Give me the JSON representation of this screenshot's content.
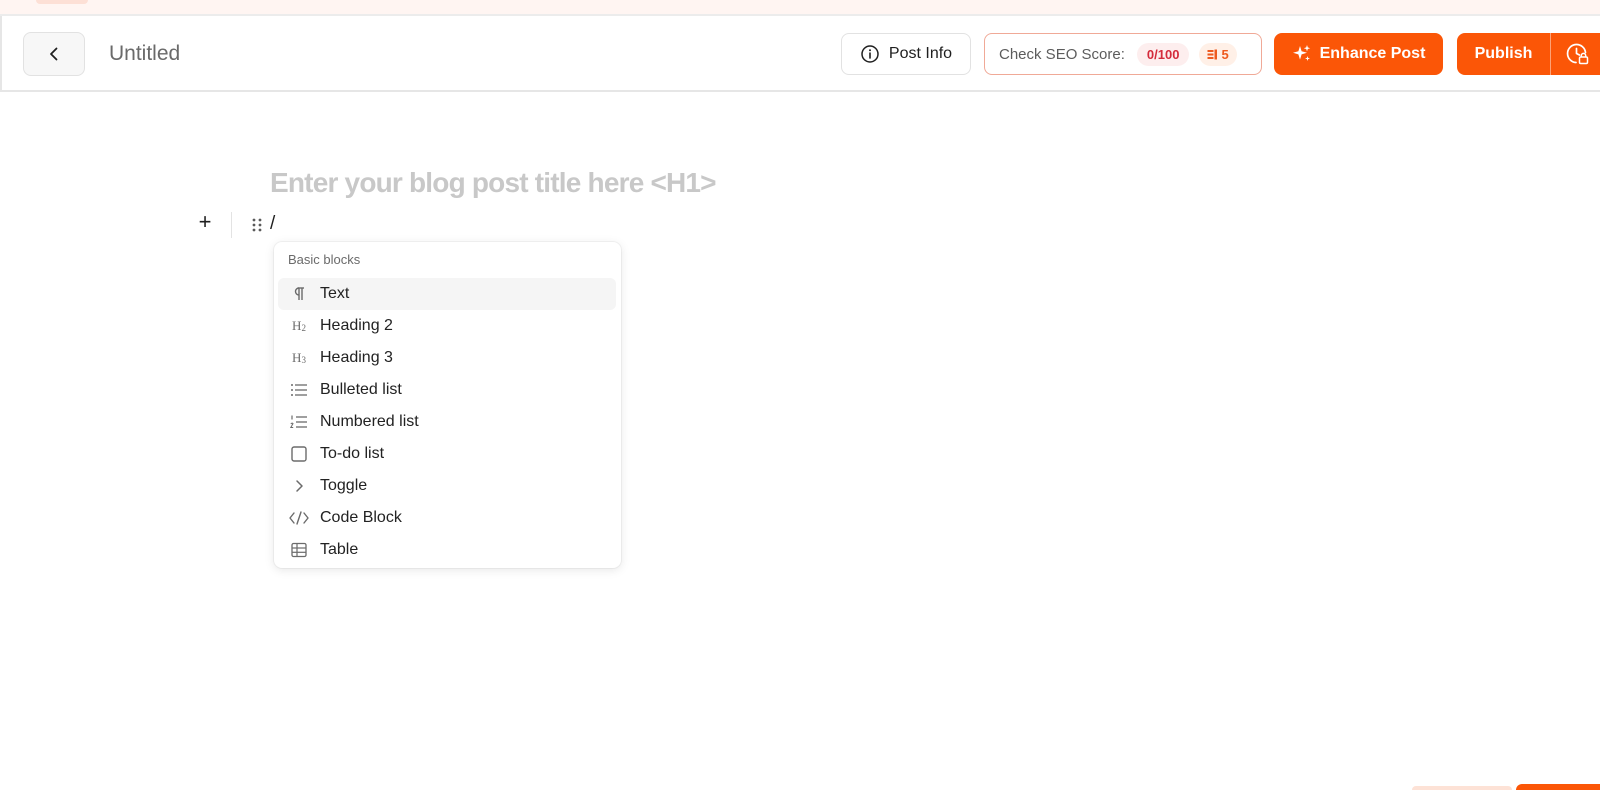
{
  "header": {
    "doc_title": "Untitled",
    "post_info_label": "Post Info",
    "seo_label": "Check SEO Score:",
    "seo_score": "0/100",
    "seo_count": "5",
    "enhance_label": "Enhance Post",
    "publish_label": "Publish"
  },
  "editor": {
    "title_placeholder": "Enter your blog post title here <H1>",
    "current_block_text": "/",
    "add_block_symbol": "+"
  },
  "block_menu": {
    "section_title": "Basic blocks",
    "items": [
      {
        "label": "Text",
        "icon": "paragraph-icon"
      },
      {
        "label": "Heading 2",
        "icon": "heading-2-icon"
      },
      {
        "label": "Heading 3",
        "icon": "heading-3-icon"
      },
      {
        "label": "Bulleted list",
        "icon": "bulleted-list-icon"
      },
      {
        "label": "Numbered list",
        "icon": "numbered-list-icon"
      },
      {
        "label": "To-do list",
        "icon": "checkbox-icon"
      },
      {
        "label": "Toggle",
        "icon": "chevron-right-icon"
      },
      {
        "label": "Code Block",
        "icon": "code-icon"
      },
      {
        "label": "Table",
        "icon": "table-icon"
      }
    ],
    "active_index": 0
  },
  "colors": {
    "accent": "#fb5607",
    "seo_border": "#f0a997",
    "score_text": "#d42b3b",
    "placeholder": "#c6c6c6"
  }
}
